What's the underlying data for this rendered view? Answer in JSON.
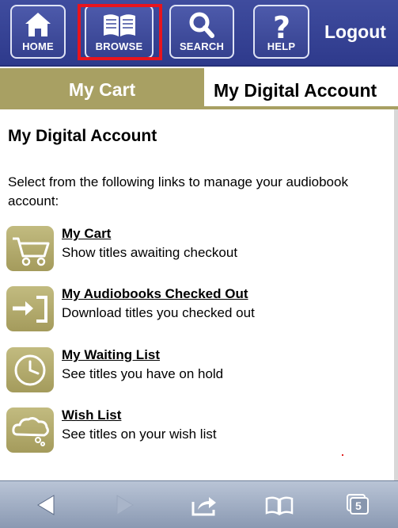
{
  "nav": {
    "home_label": "HOME",
    "browse_label": "BROWSE",
    "search_label": "SEARCH",
    "help_label": "HELP",
    "logout_label": "Logout"
  },
  "tabs": [
    {
      "label": "My Cart",
      "active": false
    },
    {
      "label": "My Digital Account",
      "active": true
    }
  ],
  "page": {
    "title": "My Digital Account",
    "intro": "Select from the following links to manage your audiobook account:"
  },
  "items": [
    {
      "icon": "cart-icon",
      "link": "My Cart",
      "desc": "Show titles awaiting checkout"
    },
    {
      "icon": "download-arrow-icon",
      "link": "My Audiobooks Checked Out",
      "desc": "Download titles you checked out"
    },
    {
      "icon": "clock-icon",
      "link": "My Waiting List",
      "desc": "See titles you have on hold"
    },
    {
      "icon": "cloud-icon",
      "link": "Wish List",
      "desc": "See titles on your wish list"
    }
  ],
  "toolbar": {
    "tabs_count": "5"
  },
  "colors": {
    "nav_bg": "#3f4c9e",
    "accent_olive": "#a8a063",
    "highlight": "#e8141d"
  }
}
